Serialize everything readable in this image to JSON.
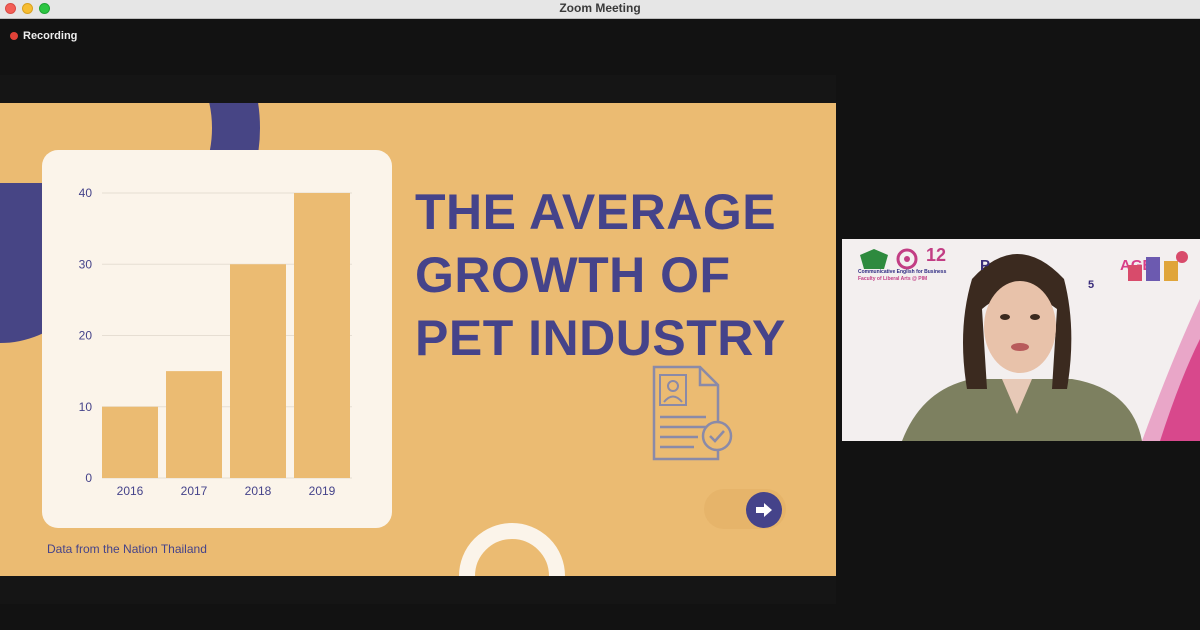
{
  "window": {
    "title": "Zoom Meeting"
  },
  "recording": {
    "label": "Recording"
  },
  "slide": {
    "title_lines": [
      "THE AVERAGE",
      "GROWTH OF",
      "PET INDUSTRY"
    ],
    "source": "Data from the Nation Thailand"
  },
  "chart_data": {
    "type": "bar",
    "categories": [
      "2016",
      "2017",
      "2018",
      "2019"
    ],
    "values": [
      10,
      15,
      30,
      40
    ],
    "yticks": [
      "0",
      "10",
      "20",
      "30",
      "40"
    ],
    "ylim": [
      0,
      40
    ],
    "grid": true,
    "bar_color": "#ebbb72"
  },
  "camera": {
    "banner_line1": "Communicative English for Business",
    "banner_line2": "Faculty of Liberal Arts @ PIM",
    "banner_logo_text": "PIM",
    "banner_number": "12",
    "banner_partial_left": "P",
    "banner_partial_right": "AGE",
    "banner_partial_num": "5"
  },
  "colors": {
    "accent": "#45438a",
    "slide_bg": "#ebbb72",
    "card": "#fbf4ea",
    "record": "#e04238"
  }
}
